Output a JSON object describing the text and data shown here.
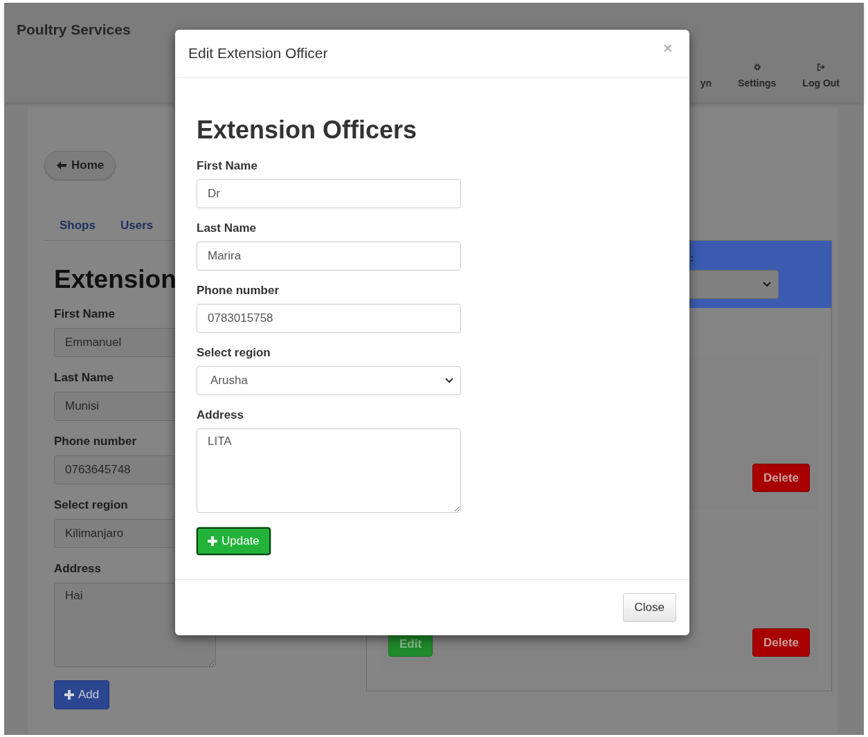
{
  "app": {
    "brand": "Poultry Services",
    "nav": [
      {
        "label": "yn",
        "kind": "plain"
      },
      {
        "label": "Settings",
        "kind": "gear"
      },
      {
        "label": "Log Out",
        "kind": "logout"
      }
    ]
  },
  "home_button": "Home",
  "tabs": [
    "Shops",
    "Users"
  ],
  "form": {
    "heading": "Extension",
    "fields": [
      {
        "label": "First Name",
        "kind": "input",
        "value": "Emmanuel"
      },
      {
        "label": "Last Name",
        "kind": "input",
        "value": "Munisi"
      },
      {
        "label": "Phone number",
        "kind": "input",
        "value": "0763645748"
      },
      {
        "label": "Select region",
        "kind": "input",
        "value": "Kilimanjaro"
      },
      {
        "label": "Address",
        "kind": "textarea",
        "value": "Hai"
      }
    ],
    "button": "Add"
  },
  "filter_panel": {
    "label": ":"
  },
  "cards": [
    {
      "buttons": [
        {
          "label": "Delete",
          "kind": "danger"
        }
      ]
    },
    {
      "buttons": [
        {
          "label": "Edit",
          "kind": "success"
        },
        {
          "label": "Delete",
          "kind": "danger"
        }
      ]
    }
  ],
  "modal": {
    "title": "Edit Extension Officer",
    "close": "×",
    "heading": "Extension Officers",
    "fields": [
      {
        "label": "First Name",
        "kind": "input",
        "value": "Dr"
      },
      {
        "label": "Last Name",
        "kind": "input",
        "value": "Marira"
      },
      {
        "label": "Phone number",
        "kind": "input",
        "value": "0783015758"
      },
      {
        "label": "Select region",
        "kind": "select",
        "value": "Arusha"
      },
      {
        "label": "Address",
        "kind": "textarea",
        "value": "LITA"
      }
    ],
    "submit": "Update",
    "footer_button": "Close"
  }
}
